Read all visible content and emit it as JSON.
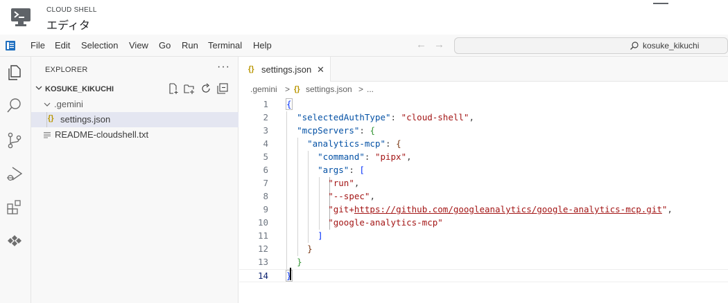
{
  "cloudshell": {
    "label": "CLOUD SHELL",
    "title": "エディタ"
  },
  "menu": {
    "items": [
      "File",
      "Edit",
      "Selection",
      "View",
      "Go",
      "Run",
      "Terminal",
      "Help"
    ],
    "back_icon": "arrow-left-icon",
    "forward_icon": "arrow-right-icon"
  },
  "command_center": {
    "text": "kosuke_kikuchi",
    "icon": "search-icon"
  },
  "activity": [
    "explorer-icon",
    "search-icon",
    "source-control-icon",
    "run-debug-icon",
    "extensions-icon",
    "gemini-icon"
  ],
  "explorer": {
    "title": "EXPLORER",
    "more": "···",
    "workspace": "KOSUKE_KIKUCHI",
    "tree": [
      {
        "label": ".gemini",
        "type": "folder"
      },
      {
        "label": "settings.json",
        "type": "json",
        "selected": true
      },
      {
        "label": "README-cloudshell.txt",
        "type": "text"
      }
    ]
  },
  "editor": {
    "tab": {
      "label": "settings.json",
      "close": "✕",
      "glyph": "{}"
    },
    "breadcrumbs": [
      ".gemini",
      ">",
      "{}",
      "settings.json",
      ">",
      "..."
    ],
    "line_numbers": [
      "1",
      "2",
      "3",
      "4",
      "5",
      "6",
      "7",
      "8",
      "9",
      "10",
      "11",
      "12",
      "13",
      "14"
    ],
    "code": {
      "key_selectedAuthType": "\"selectedAuthType\"",
      "val_selectedAuthType": "\"cloud-shell\"",
      "key_mcpServers": "\"mcpServers\"",
      "key_analytics": "\"analytics-mcp\"",
      "key_command": "\"command\"",
      "val_command": "\"pipx\"",
      "key_args": "\"args\"",
      "arg_run": "\"run\"",
      "arg_spec": "\"--spec\"",
      "arg_git_prefix": "\"git+",
      "arg_git_url": "https://github.com/googleanalytics/google-analytics-mcp.git",
      "arg_git_suffix": "\"",
      "arg_name": "\"google-analytics-mcp\""
    }
  }
}
